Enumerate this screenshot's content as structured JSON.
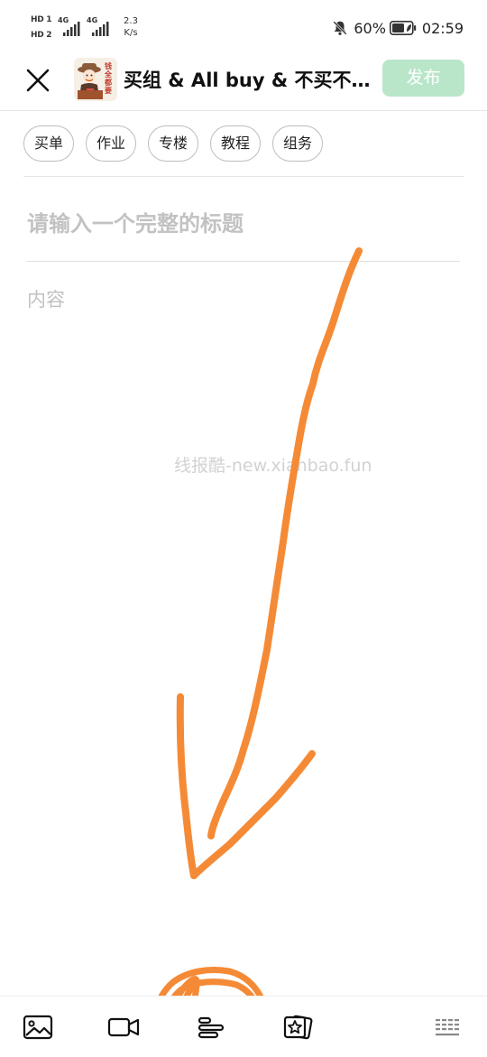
{
  "status_bar": {
    "hd1": "HD 1",
    "hd2": "HD 2",
    "sim1_network": "4G",
    "sim2_network": "4G",
    "speed_value": "2.3",
    "speed_unit": "K/s",
    "battery_percent": "60%",
    "time": "02:59"
  },
  "header": {
    "group_name": "买组 & All buy & 不买不…",
    "avatar_lettering": "钱全都要",
    "publish_label": "发布"
  },
  "tags": [
    {
      "label": "买单"
    },
    {
      "label": "作业"
    },
    {
      "label": "专楼"
    },
    {
      "label": "教程"
    },
    {
      "label": "组务"
    }
  ],
  "editor": {
    "title_placeholder": "请输入一个完整的标题",
    "content_placeholder": "内容"
  },
  "watermark": "线报酷-new.xianbao.fun",
  "toolbar": {
    "icons": [
      "image-icon",
      "video-icon",
      "text-format-icon",
      "star-card-icon",
      "keyboard-icon"
    ]
  },
  "colors": {
    "publish_bg": "#b9e6c9",
    "annotation": "#f58a36",
    "placeholder": "#c2c2c2"
  }
}
